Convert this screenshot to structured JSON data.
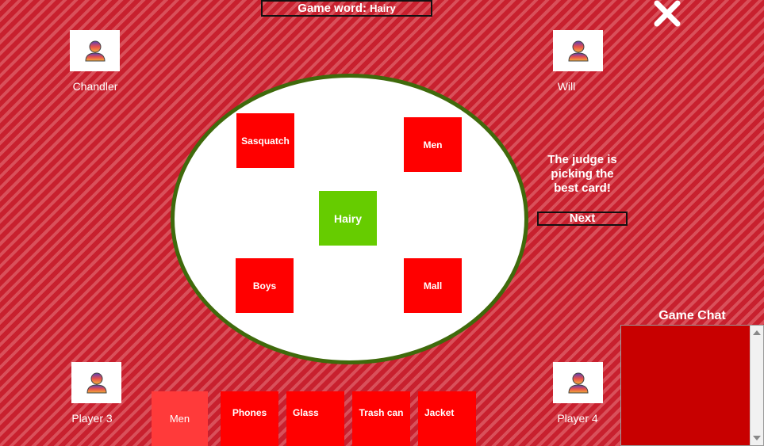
{
  "header": {
    "game_word_label": "Game word:",
    "game_word_value": "Hairy"
  },
  "players": [
    {
      "name": "Chandler"
    },
    {
      "name": "Will"
    },
    {
      "name": "Player 3"
    },
    {
      "name": "Player 4"
    }
  ],
  "table": {
    "center_card": "Hairy",
    "submitted_cards": [
      "Sasquatch",
      "Men",
      "Boys",
      "Mall"
    ]
  },
  "status": {
    "judge_message": "The judge is picking the best card!",
    "next_label": "Next"
  },
  "hand": [
    "Men",
    "Phones",
    "Glass",
    "Trash can",
    "Jacket"
  ],
  "chat": {
    "title": "Game Chat"
  },
  "colors": {
    "background": "#c8202e",
    "card": "#ff0000",
    "center_card": "#66cc00",
    "table_border": "#3f6a0c",
    "chat": "#c80000"
  }
}
